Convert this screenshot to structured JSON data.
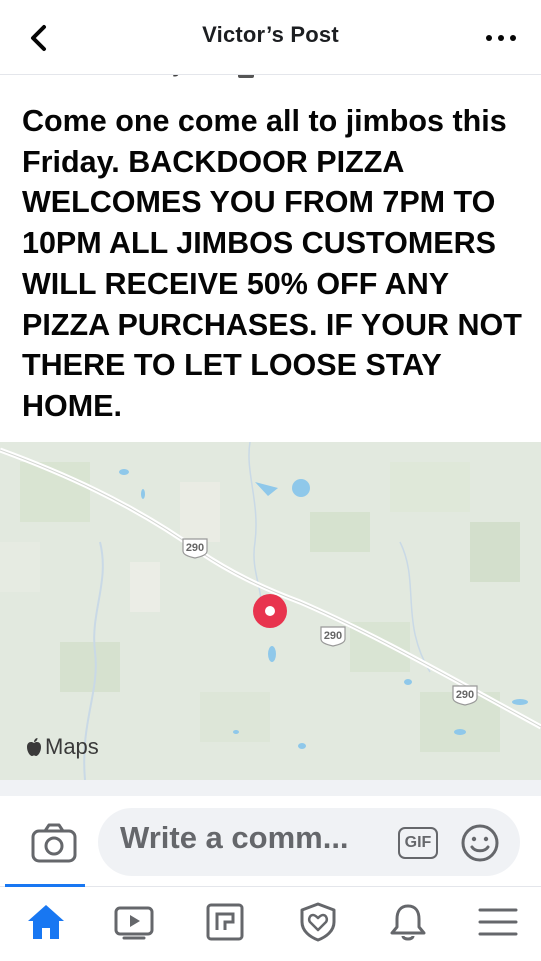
{
  "header": {
    "title": "Victor’s Post",
    "back_icon": "chevron-left-icon",
    "more_icon": "more-horizontal-icon"
  },
  "post": {
    "text": "Come one come all to jimbos this Friday. BACKDOOR PIZZA WELCOMES YOU FROM 7PM TO 10PM ALL JIMBOS CUSTOMERS WILL RECEIVE 50% OFF ANY PIZZA PURCHASES. IF YOUR NOT THERE TO LET LOOSE STAY HOME.",
    "partial_label": "Hockley"
  },
  "map": {
    "route_shields": [
      "290",
      "290",
      "290"
    ],
    "attribution": "Maps",
    "pin_color": "#e8344e"
  },
  "comment": {
    "placeholder": "Write a comm...",
    "gif_label": "GIF",
    "camera_icon": "camera-icon",
    "emoji_icon": "smiley-icon"
  },
  "tabbar": {
    "active_color": "#1877f2",
    "items": [
      {
        "name": "home",
        "icon": "home-icon",
        "active": true
      },
      {
        "name": "watch",
        "icon": "video-icon",
        "active": false
      },
      {
        "name": "pages",
        "icon": "pages-flag-icon",
        "active": false
      },
      {
        "name": "groups",
        "icon": "shield-heart-icon",
        "active": false
      },
      {
        "name": "notifications",
        "icon": "bell-icon",
        "active": false
      },
      {
        "name": "menu",
        "icon": "menu-icon",
        "active": false
      }
    ]
  }
}
